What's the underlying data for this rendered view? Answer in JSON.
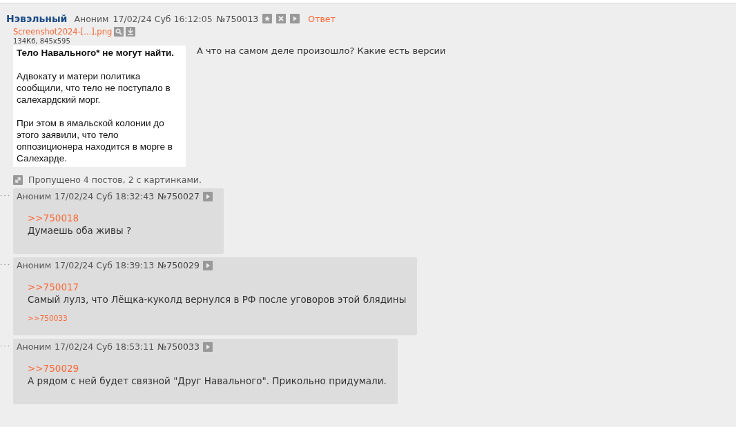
{
  "op": {
    "subject": "Нэвэльный",
    "name": "Аноним",
    "date": "17/02/24 Суб 16:12:05",
    "number": "№750013",
    "reply_link": "Ответ",
    "file": {
      "name": "Screenshot2024-[...].png",
      "info": "134Кб, 845x595"
    },
    "thumbnail": {
      "heading": "Тело Навального* не могут найти.",
      "paragraphs": [
        "Адвокату и матери политика сообщили, что тело не поступало в салехардский морг.",
        "При этом в ямальской колонии до этого заявили, что тело оппозиционера находится в морге в Салехарде."
      ]
    },
    "text": "А что на самом деле произошло? Какие есть версии"
  },
  "omitted": "Пропущено 4 постов, 2 с картинками.",
  "replies": [
    {
      "name": "Аноним",
      "date": "17/02/24 Суб 18:32:43",
      "number": "№750027",
      "quote": ">>750018",
      "text": "Думаешь оба живы ?"
    },
    {
      "name": "Аноним",
      "date": "17/02/24 Суб 18:39:13",
      "number": "№750029",
      "quote": ">>750017",
      "text": "Самый лулз, что Лёщка-куколд вернулся в РФ после уговоров этой блядины",
      "backlinks": [
        ">>750033"
      ]
    },
    {
      "name": "Аноним",
      "date": "17/02/24 Суб 18:53:11",
      "number": "№750033",
      "quote": ">>750029",
      "text": "А рядом с ней будет связной \"Друг Навального\". Прикольно придумали."
    }
  ]
}
